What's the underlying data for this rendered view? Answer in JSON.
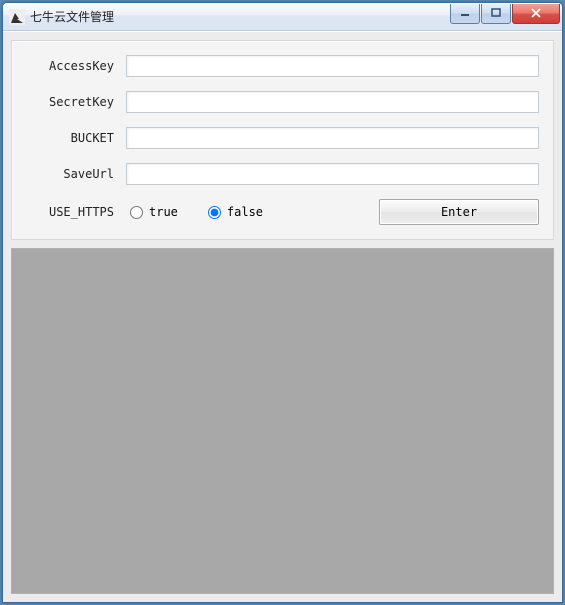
{
  "window": {
    "title": "七牛云文件管理"
  },
  "form": {
    "accesskey_label": "AccessKey",
    "accesskey_value": "",
    "secretkey_label": "SecretKey",
    "secretkey_value": "",
    "bucket_label": "BUCKET",
    "bucket_value": "",
    "saveurl_label": "SaveUrl",
    "saveurl_value": "",
    "use_https_label": "USE_HTTPS",
    "radio_true_label": "true",
    "radio_false_label": "false",
    "use_https_selected": "false",
    "enter_button_label": "Enter"
  }
}
